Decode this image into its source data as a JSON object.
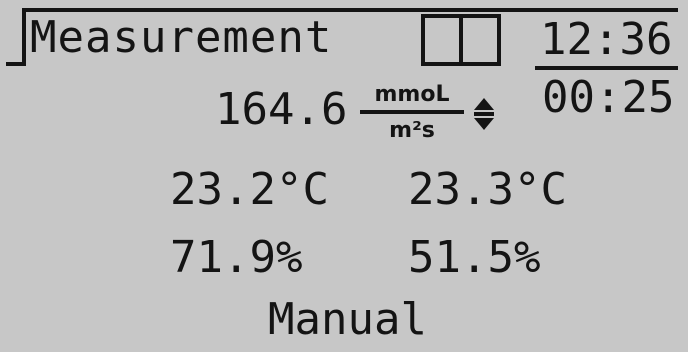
{
  "screen": {
    "title": "Measurement",
    "clock": "12:36",
    "elapsed": "00:25"
  },
  "flux": {
    "value": "164.6",
    "unit_numerator": "mmoL",
    "unit_denominator": "m²s"
  },
  "readings": {
    "temp_1": "23.2°C",
    "temp_2": "23.3°C",
    "humidity_1": "71.9%",
    "humidity_2": "51.5%"
  },
  "mode": "Manual",
  "icons": {
    "battery": "battery-icon",
    "adjust": "up-down-arrows-icon"
  },
  "colors": {
    "lcd_background": "#c7c7c7",
    "lcd_ink": "#141414"
  }
}
